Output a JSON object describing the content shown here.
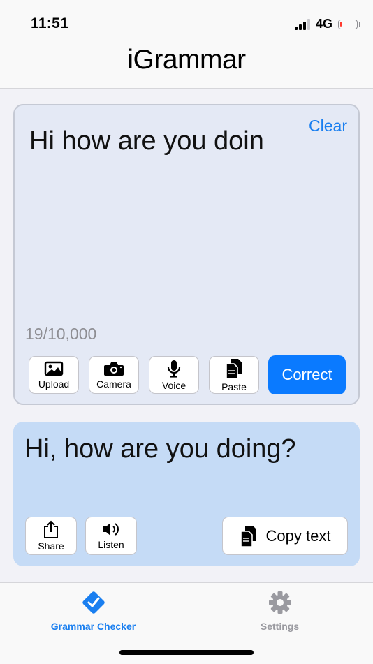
{
  "status_bar": {
    "time": "11:51",
    "network": "4G",
    "battery_level_fraction": 0.1,
    "battery_color": "#ff3b30"
  },
  "header": {
    "title": "iGrammar"
  },
  "input_card": {
    "clear_label": "Clear",
    "text": "Hi how are you doin",
    "char_count": "19/10,000",
    "tools": [
      {
        "label": "Upload",
        "icon": "image-icon"
      },
      {
        "label": "Camera",
        "icon": "camera-icon"
      },
      {
        "label": "Voice",
        "icon": "microphone-icon"
      },
      {
        "label": "Paste",
        "icon": "paste-icon"
      }
    ],
    "correct_label": "Correct"
  },
  "output_card": {
    "text": "Hi, how are you doing?",
    "share_label": "Share",
    "listen_label": "Listen",
    "copy_label": "Copy text"
  },
  "tab_bar": {
    "tabs": [
      {
        "label": "Grammar Checker",
        "icon": "checkmark-badge-icon",
        "active": true
      },
      {
        "label": "Settings",
        "icon": "gear-icon",
        "active": false
      }
    ]
  },
  "colors": {
    "accent": "#0a7aff",
    "link": "#1a7ff0",
    "input_card_bg": "#e4e9f5",
    "output_card_bg": "#c5dbf6",
    "inactive_tab": "#9a9aa0"
  }
}
